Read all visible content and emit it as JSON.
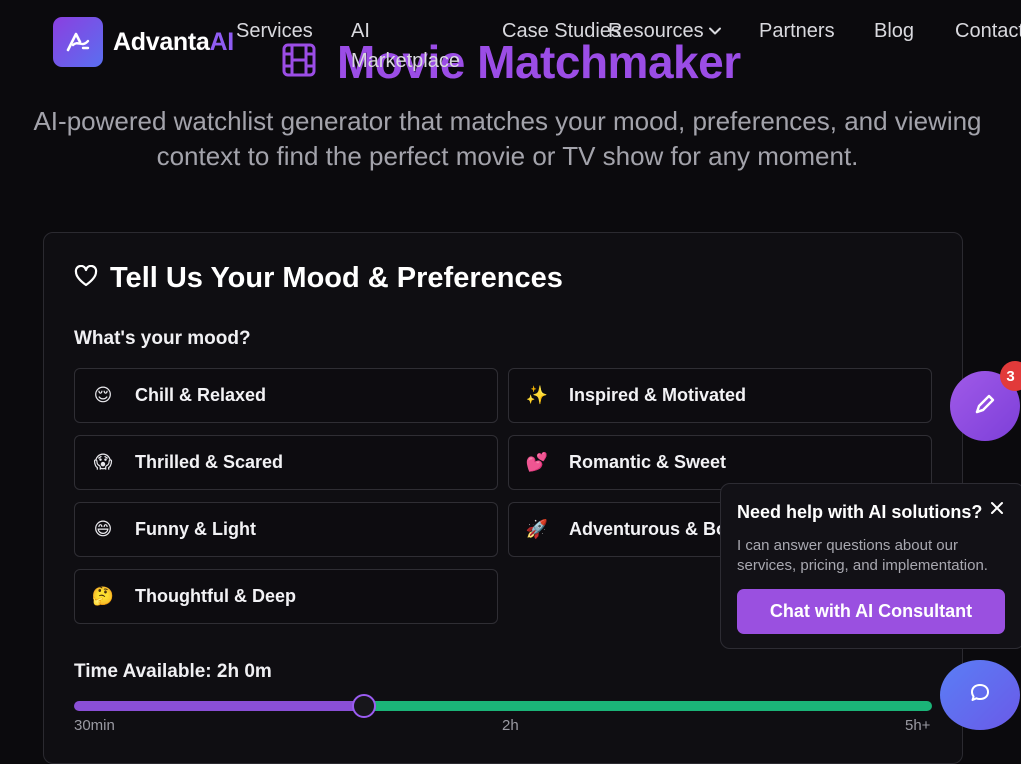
{
  "brand": {
    "name_main": "Advanta",
    "name_accent": "AI"
  },
  "nav": {
    "services": "Services",
    "ai_marketplace": "AI Marketplace",
    "case_studies": "Case Studies",
    "resources": "Resources",
    "partners": "Partners",
    "blog": "Blog",
    "contact": "Contact"
  },
  "hero": {
    "title": "Movie Matchmaker",
    "subtitle": "AI-powered watchlist generator that matches your mood, preferences, and viewing context to find the perfect movie or TV show for any moment."
  },
  "preferences": {
    "title": "Tell Us Your Mood & Preferences",
    "mood_label": "What's your mood?",
    "moods": [
      {
        "emoji": "😌",
        "label": "Chill & Relaxed"
      },
      {
        "emoji": "✨",
        "label": "Inspired & Motivated"
      },
      {
        "emoji": "😱",
        "label": "Thrilled & Scared"
      },
      {
        "emoji": "💕",
        "label": "Romantic & Sweet"
      },
      {
        "emoji": "😄",
        "label": "Funny & Light"
      },
      {
        "emoji": "🚀",
        "label": "Adventurous & Bold"
      },
      {
        "emoji": "🤔",
        "label": "Thoughtful & Deep"
      }
    ],
    "time_label": "Time Available: 2h 0m",
    "time_slider": {
      "min_label": "30min",
      "mid_label": "2h",
      "max_label": "5h+",
      "value_fraction": 0.31
    }
  },
  "notifications": {
    "count": "3"
  },
  "chat_popup": {
    "title": "Need help with AI solutions?",
    "body": "I can answer questions about our services, pricing, and implementation.",
    "button": "Chat with AI Consultant"
  },
  "colors": {
    "accent": "#9b4de6",
    "button": "#9a50e0",
    "slider_left": "#8a4fd6",
    "slider_right": "#1bb478",
    "badge": "#e23a3a",
    "background": "#0b0a0d"
  },
  "icons": {
    "logo": "advanta-logo-icon",
    "film": "film-icon",
    "heart": "heart-icon",
    "edit": "pencil-icon",
    "close": "close-icon",
    "chat": "chat-bubble-icon",
    "chevron": "chevron-down-icon"
  }
}
